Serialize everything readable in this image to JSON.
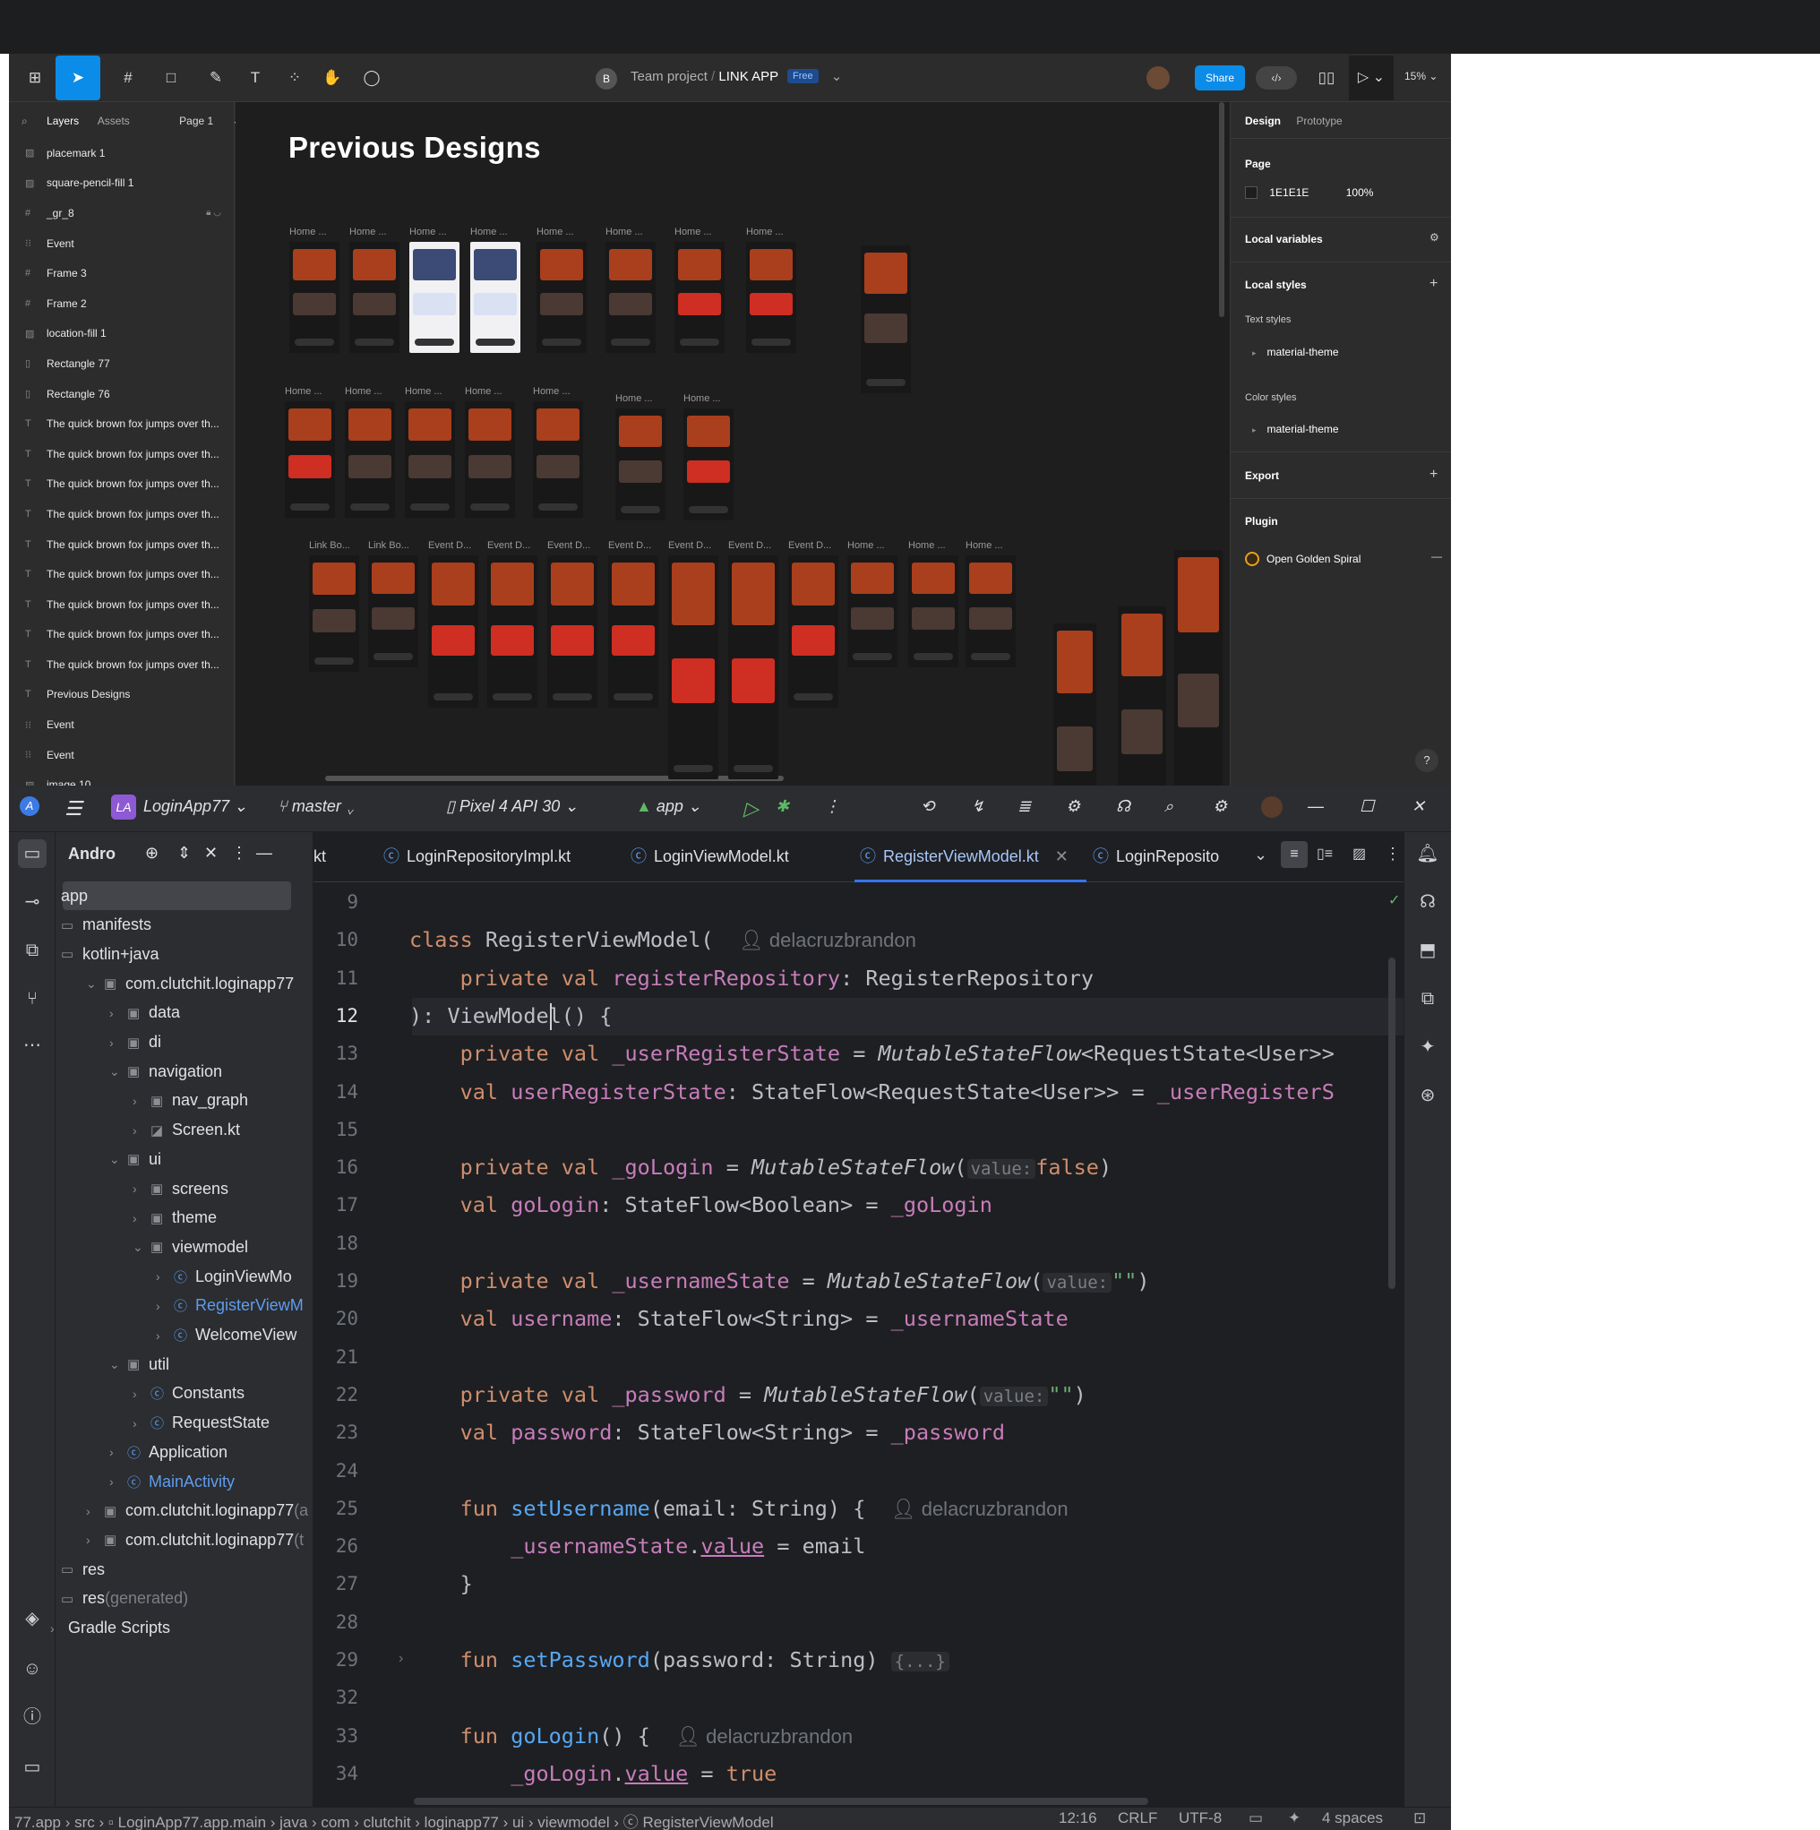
{
  "figma": {
    "toolbar": {
      "team": "Team project",
      "project": "LINK APP",
      "badge": "Free",
      "avatar_letter": "B",
      "share_label": "Share",
      "zoom": "15%"
    },
    "left_panel": {
      "tab_layers": "Layers",
      "tab_assets": "Assets",
      "page": "Page 1",
      "layers": [
        {
          "icon": "▨",
          "name": "placemark 1"
        },
        {
          "icon": "▨",
          "name": "square-pencil-fill 1"
        },
        {
          "icon": "#",
          "name": "_gr_8"
        },
        {
          "icon": "⁝⁝",
          "name": "Event"
        },
        {
          "icon": "#",
          "name": "Frame 3"
        },
        {
          "icon": "#",
          "name": "Frame 2"
        },
        {
          "icon": "▨",
          "name": "location-fill 1"
        },
        {
          "icon": "▯",
          "name": "Rectangle 77"
        },
        {
          "icon": "▯",
          "name": "Rectangle 76"
        },
        {
          "icon": "T",
          "name": "The quick brown fox jumps over th..."
        },
        {
          "icon": "T",
          "name": "The quick brown fox jumps over th..."
        },
        {
          "icon": "T",
          "name": "The quick brown fox jumps over th..."
        },
        {
          "icon": "T",
          "name": "The quick brown fox jumps over th..."
        },
        {
          "icon": "T",
          "name": "The quick brown fox jumps over th..."
        },
        {
          "icon": "T",
          "name": "The quick brown fox jumps over th..."
        },
        {
          "icon": "T",
          "name": "The quick brown fox jumps over th..."
        },
        {
          "icon": "T",
          "name": "The quick brown fox jumps over th..."
        },
        {
          "icon": "T",
          "name": "The quick brown fox jumps over th..."
        },
        {
          "icon": "T",
          "name": "Previous Designs"
        },
        {
          "icon": "⁝⁝",
          "name": "Event"
        },
        {
          "icon": "⁝⁝",
          "name": "Event"
        },
        {
          "icon": "▨",
          "name": "image 10"
        }
      ]
    },
    "canvas": {
      "title": "Previous Designs",
      "label_home": "Home ...",
      "label_link": "Link Bo...",
      "label_event": "Event D..."
    },
    "right_panel": {
      "tab_design": "Design",
      "tab_prototype": "Prototype",
      "page_heading": "Page",
      "page_color": "1E1E1E",
      "page_opacity": "100%",
      "local_variables": "Local variables",
      "local_styles": "Local styles",
      "text_styles": "Text styles",
      "text_style_item": "material-theme",
      "color_styles": "Color styles",
      "color_style_item": "material-theme",
      "export": "Export",
      "plugin": "Plugin",
      "plugin_item": "Open Golden Spiral",
      "help": "?"
    }
  },
  "studio": {
    "toolbar": {
      "project_badge": "LA",
      "project": "LoginApp77",
      "branch": "master",
      "device": "Pixel 4 API 30",
      "config": "app"
    },
    "project_panel": {
      "title": "Andro"
    },
    "tree": [
      {
        "d": 0,
        "label": "app",
        "icon": "",
        "arrow": ""
      },
      {
        "d": 0,
        "label": "manifests",
        "icon": "▭",
        "arrow": ""
      },
      {
        "d": 0,
        "label": "kotlin+java",
        "icon": "▭",
        "arrow": ""
      },
      {
        "d": 1,
        "label": "com.clutchit.loginapp77",
        "icon": "▣",
        "arrow": "⌄"
      },
      {
        "d": 2,
        "label": "data",
        "icon": "▣",
        "arrow": "›"
      },
      {
        "d": 2,
        "label": "di",
        "icon": "▣",
        "arrow": "›"
      },
      {
        "d": 2,
        "label": "navigation",
        "icon": "▣",
        "arrow": "⌄"
      },
      {
        "d": 3,
        "label": "nav_graph",
        "icon": "▣",
        "arrow": "›"
      },
      {
        "d": 3,
        "label": "Screen.kt",
        "icon": "◪",
        "arrow": "›"
      },
      {
        "d": 2,
        "label": "ui",
        "icon": "▣",
        "arrow": "⌄"
      },
      {
        "d": 3,
        "label": "screens",
        "icon": "▣",
        "arrow": "›"
      },
      {
        "d": 3,
        "label": "theme",
        "icon": "▣",
        "arrow": "›"
      },
      {
        "d": 3,
        "label": "viewmodel",
        "icon": "▣",
        "arrow": "⌄"
      },
      {
        "d": 4,
        "label": "LoginViewMo",
        "icon": "ⓒ",
        "arrow": "›"
      },
      {
        "d": 4,
        "label": "RegisterViewM",
        "icon": "ⓒ",
        "arrow": "›",
        "blue": true
      },
      {
        "d": 4,
        "label": "WelcomeView",
        "icon": "ⓒ",
        "arrow": "›"
      },
      {
        "d": 2,
        "label": "util",
        "icon": "▣",
        "arrow": "⌄"
      },
      {
        "d": 3,
        "label": "Constants",
        "icon": "ⓒ",
        "arrow": "›"
      },
      {
        "d": 3,
        "label": "RequestState",
        "icon": "ⓒ",
        "arrow": "›"
      },
      {
        "d": 2,
        "label": "Application",
        "icon": "ⓒ",
        "arrow": "›"
      },
      {
        "d": 2,
        "label": "MainActivity",
        "icon": "ⓒ",
        "arrow": "›",
        "blue": true
      },
      {
        "d": 1,
        "label": "com.clutchit.loginapp77",
        "icon": "▣",
        "arrow": "›",
        "suffix": " (a"
      },
      {
        "d": 1,
        "label": "com.clutchit.loginapp77",
        "icon": "▣",
        "arrow": "›",
        "suffix": " (t"
      },
      {
        "d": 0,
        "label": "res",
        "icon": "▭",
        "arrow": ""
      },
      {
        "d": 0,
        "label": "res",
        "icon": "▭",
        "arrow": "",
        "suffix": " (generated)"
      },
      {
        "d": -1,
        "label": "Gradle Scripts",
        "icon": "",
        "arrow": "›"
      }
    ],
    "tabs": [
      "kt",
      "LoginRepositoryImpl.kt",
      "LoginViewModel.kt",
      "RegisterViewModel.kt",
      "LoginReposito"
    ],
    "active_tab": "RegisterViewModel.kt",
    "code": {
      "author": "delacruzbrandon",
      "class_kw": "class",
      "class_name": "RegisterViewModel(",
      "line11_kw": "private val",
      "line11_prop": "registerRepository",
      "line11_type": ": RegisterRepository",
      "line12": "): ViewModel() {",
      "line13_kw": "private val",
      "line13_prop": "_userRegisterState",
      "line13_eq": " = ",
      "line13_fn": "MutableStateFlow",
      "line13_rest": "<RequestState<User>>",
      "line14_kw": "val",
      "line14_prop": "userRegisterState",
      "line14_rest": ": StateFlow<RequestState<User>> = ",
      "line14_ref": "_userRegisterS",
      "line16_kw": "private val",
      "line16_prop": "_goLogin",
      "line16_eq": " = ",
      "line16_fn": "MutableStateFlow",
      "hint_value": "value:",
      "line16_val": "false",
      "line17_kw": "val",
      "line17_prop": "goLogin",
      "line17_rest": ": StateFlow<Boolean> = ",
      "line17_ref": "_goLogin",
      "line19_kw": "private val",
      "line19_prop": "_usernameState",
      "line19_eq": " = ",
      "line19_fn": "MutableStateFlow",
      "line19_val": "\"\"",
      "line20_kw": "val",
      "line20_prop": "username",
      "line20_rest": ": StateFlow<String> = ",
      "line20_ref": "_usernameState",
      "line22_kw": "private val",
      "line22_prop": "_password",
      "line22_eq": " = ",
      "line22_fn": "MutableStateFlow",
      "line22_val": "\"\"",
      "line23_kw": "val",
      "line23_prop": "password",
      "line23_rest": ": StateFlow<String> = ",
      "line23_ref": "_password",
      "line25_kw": "fun",
      "line25_fn": "setUsername",
      "line25_rest": "(email: String) {",
      "line26_ref": "_usernameState",
      "line26_dot": ".",
      "line26_val": "value",
      "line26_rest": " = email",
      "line27": "}",
      "line29_kw": "fun",
      "line29_fn": "setPassword",
      "line29_rest": "(password: String) ",
      "line29_fold": "{...}",
      "line33_kw": "fun",
      "line33_fn": "goLogin",
      "line33_rest": "() {",
      "line34_ref": "_goLogin",
      "line34_dot": ".",
      "line34_val": "value",
      "line34_eq": " = ",
      "line34_true": "true"
    },
    "line_numbers": [
      "9",
      "10",
      "11",
      "12",
      "13",
      "14",
      "15",
      "16",
      "17",
      "18",
      "19",
      "20",
      "21",
      "22",
      "23",
      "24",
      "25",
      "26",
      "27",
      "28",
      "29",
      "32",
      "33",
      "34"
    ],
    "status": {
      "breadcrumb": "77.app  ›  src  ›  ▫ LoginApp77.app.main  ›  java  ›  com  ›  clutchit  ›  loginapp77  ›  ui  ›  viewmodel  ›  ⓒ RegisterViewModel",
      "position": "12:16",
      "line_sep": "CRLF",
      "encoding": "UTF-8",
      "indent": "4 spaces"
    }
  }
}
